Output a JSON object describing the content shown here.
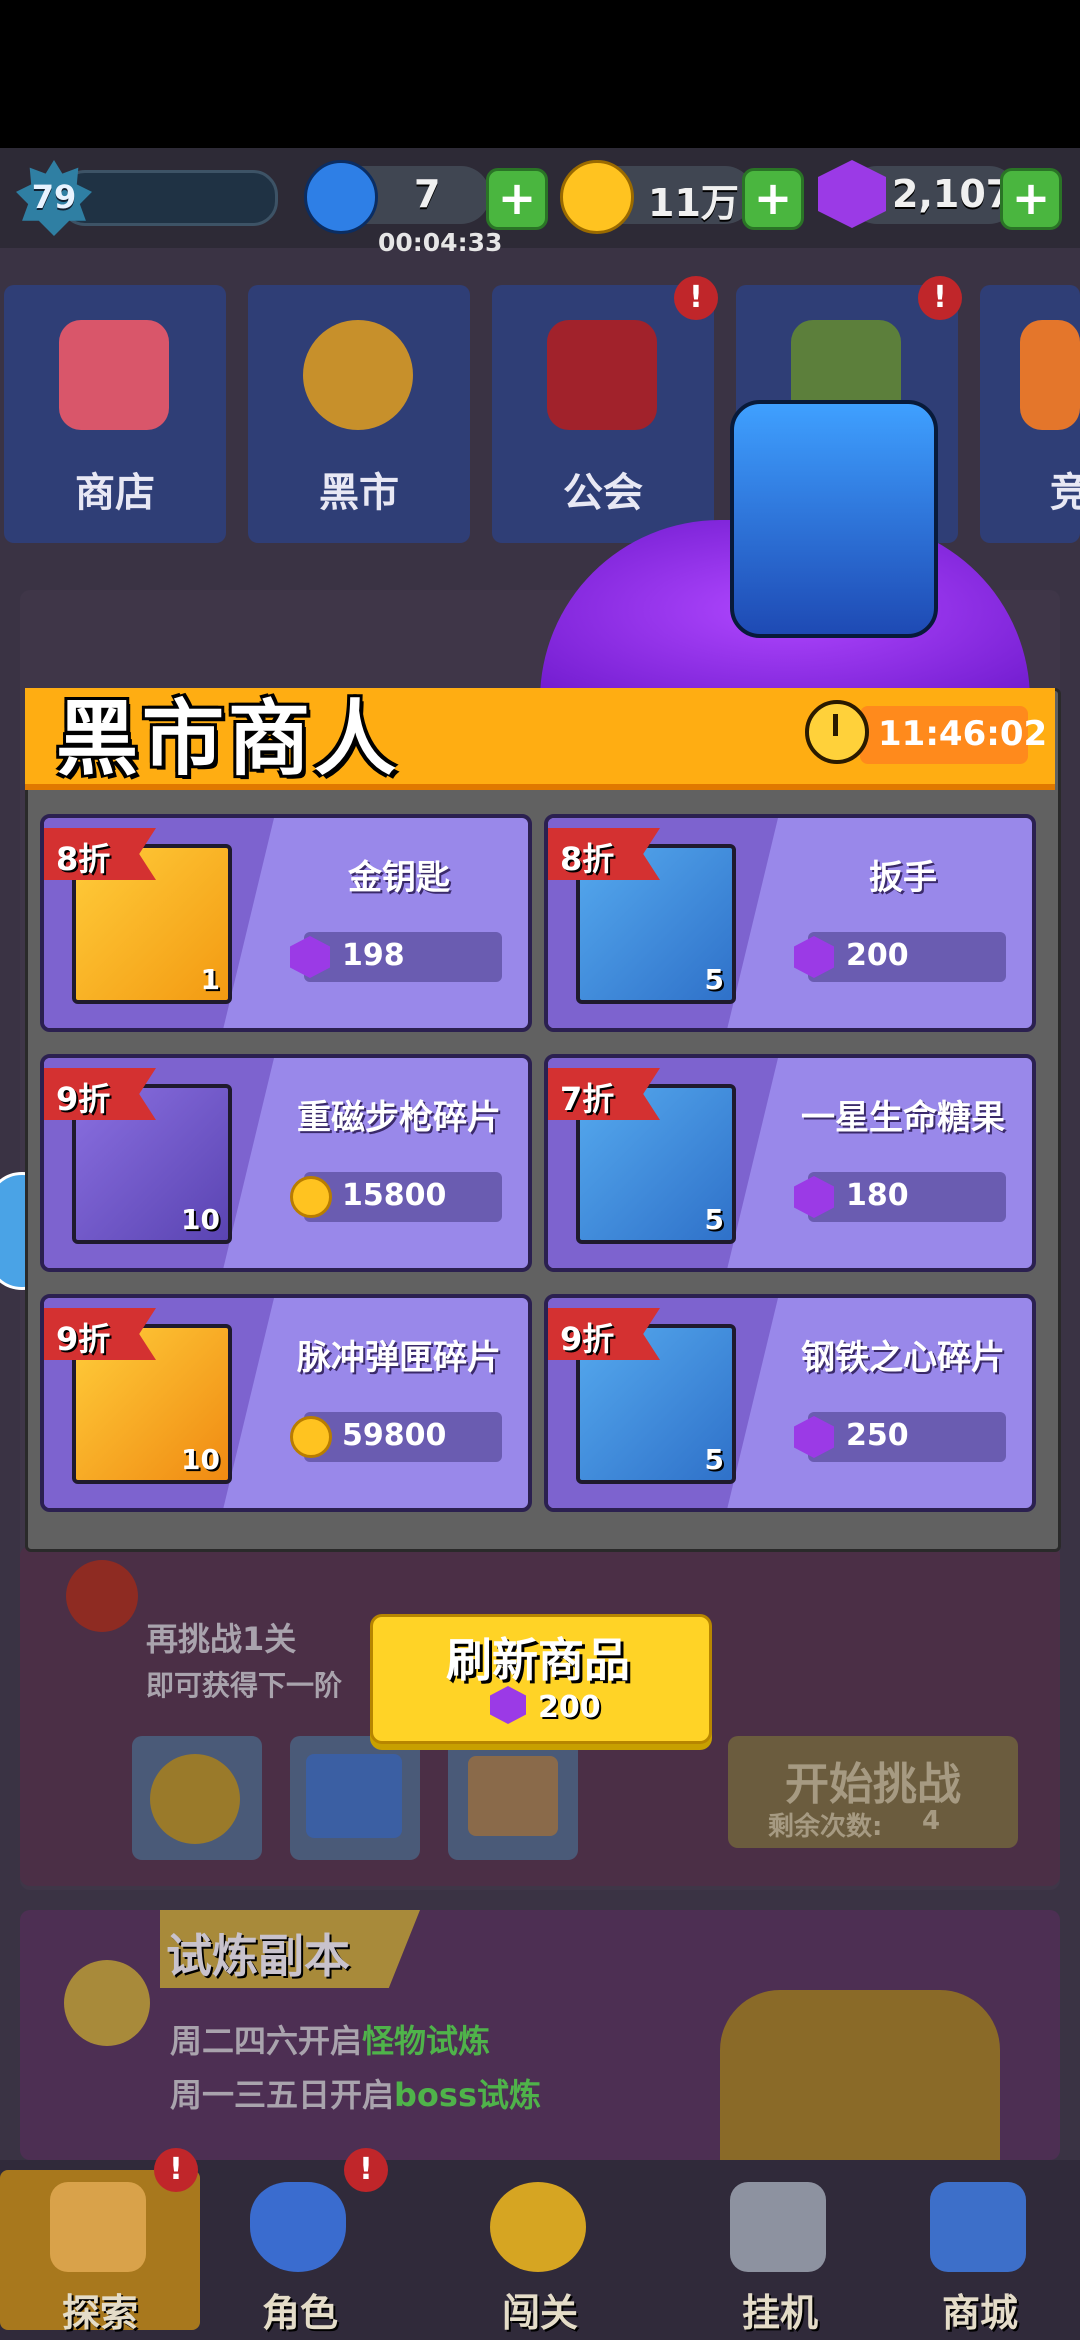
{
  "status": {
    "level": "79",
    "energy": "7",
    "energy_timer": "00:04:33",
    "gold": "11万",
    "gems": "2,107",
    "plus": "+"
  },
  "menu": [
    {
      "label": "商店",
      "icon": "shop-icon"
    },
    {
      "label": "黑市",
      "icon": "black-market-icon"
    },
    {
      "label": "公会",
      "icon": "guild-icon"
    },
    {
      "label": "",
      "icon": "fence-icon"
    },
    {
      "label": "竞",
      "icon": "arena-icon"
    }
  ],
  "badge_mark": "!",
  "modal": {
    "title": "黑市商人",
    "timer": "11:46:02",
    "items": [
      {
        "name": "金钥匙",
        "discount": "8折",
        "qty": "1",
        "price": "198",
        "currency": "gem",
        "bg": "gold",
        "icon": "gold-key-icon"
      },
      {
        "name": "扳手",
        "discount": "8折",
        "qty": "5",
        "price": "200",
        "currency": "gem",
        "bg": "blue",
        "icon": "wrench-icon"
      },
      {
        "name": "重磁步枪碎片",
        "discount": "9折",
        "qty": "10",
        "price": "15800",
        "currency": "coin",
        "bg": "purple",
        "icon": "magnetic-rifle-icon"
      },
      {
        "name": "一星生命糖果",
        "discount": "7折",
        "qty": "5",
        "price": "180",
        "currency": "gem",
        "bg": "blue",
        "icon": "life-candy-icon"
      },
      {
        "name": "脉冲弹匣碎片",
        "discount": "9折",
        "qty": "10",
        "price": "59800",
        "currency": "coin",
        "bg": "orange",
        "icon": "pulse-magazine-icon"
      },
      {
        "name": "钢铁之心碎片",
        "discount": "9折",
        "qty": "5",
        "price": "250",
        "currency": "gem",
        "bg": "blue",
        "icon": "iron-heart-icon"
      }
    ],
    "refresh": {
      "label": "刷新商品",
      "price": "200"
    }
  },
  "background": {
    "challenge_line1": "再挑战1关",
    "challenge_line2": "即可获得下一阶",
    "start_label": "开始挑战",
    "remaining_label": "剩余次数:",
    "remaining_value": "4",
    "trial_title": "试炼副本",
    "trial_line1_prefix": "周二四六开启",
    "trial_line1_highlight": "怪物试炼",
    "trial_line2_prefix": "周一三五日开启",
    "trial_line2_highlight": "boss试炼"
  },
  "nav": [
    {
      "label": "探索",
      "icon": "map-icon",
      "active": true
    },
    {
      "label": "角色",
      "icon": "character-shield-icon",
      "active": false
    },
    {
      "label": "闯关",
      "icon": "stage-skull-icon",
      "active": false
    },
    {
      "label": "挂机",
      "icon": "gamepad-icon",
      "active": false
    },
    {
      "label": "商城",
      "icon": "mall-shop-icon",
      "active": false
    }
  ],
  "colors": {
    "header_orange": "#ffad12",
    "card_purple": "#9988ea",
    "discount_red": "#d43131",
    "button_yellow": "#ffd326"
  }
}
